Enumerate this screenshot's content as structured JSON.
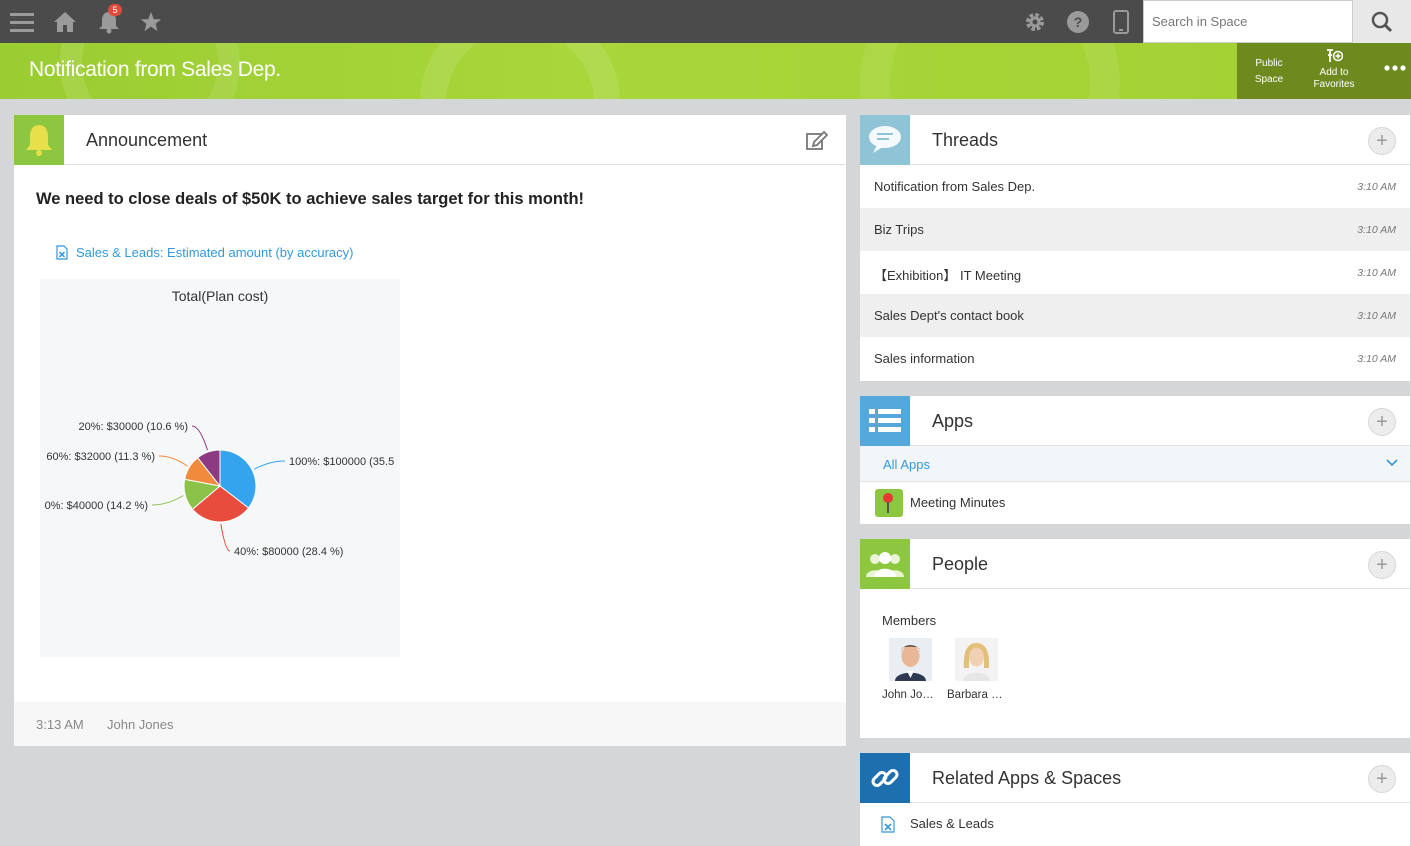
{
  "header": {
    "notification_count": "5",
    "search_placeholder": "Search in Space"
  },
  "space": {
    "title": "Notification from Sales Dep.",
    "public_label_1": "Public",
    "public_label_2": "Space",
    "favorites_label_1": "Add to",
    "favorites_label_2": "Favorites"
  },
  "announcement": {
    "title": "Announcement",
    "headline": "We need to close deals of $50K to achieve sales target for this month!",
    "link_text": "Sales & Leads: Estimated amount (by accuracy)",
    "footer_time": "3:13 AM",
    "footer_author": "John Jones"
  },
  "chart_data": {
    "type": "pie",
    "title": "Total(Plan cost)",
    "slices": [
      {
        "label": "100%: $100000 (35.5",
        "value": 100000,
        "percent": 35.5,
        "color": "#35a4ee"
      },
      {
        "label": "40%: $80000 (28.4 %)",
        "value": 80000,
        "percent": 28.4,
        "color": "#e74c3c"
      },
      {
        "label": "0%: $40000 (14.2 %)",
        "value": 40000,
        "percent": 14.2,
        "color": "#8bc34a"
      },
      {
        "label": "60%: $32000 (11.3 %)",
        "value": 32000,
        "percent": 11.3,
        "color": "#f08a3c"
      },
      {
        "label": "20%: $30000 (10.6 %)",
        "value": 30000,
        "percent": 10.6,
        "color": "#8e3a82"
      }
    ]
  },
  "threads": {
    "title": "Threads",
    "items": [
      {
        "name": "Notification from Sales Dep.",
        "time": "3:10 AM"
      },
      {
        "name": "Biz Trips",
        "time": "3:10 AM"
      },
      {
        "name": "【Exhibition】 IT Meeting",
        "time": "3:10 AM"
      },
      {
        "name": "Sales Dept's contact book",
        "time": "3:10 AM"
      },
      {
        "name": "Sales information",
        "time": "3:10 AM"
      }
    ]
  },
  "apps": {
    "title": "Apps",
    "filter": "All Apps",
    "items": [
      {
        "name": "Meeting Minutes"
      }
    ]
  },
  "people": {
    "title": "People",
    "members_label": "Members",
    "members": [
      {
        "name": "John Jo…"
      },
      {
        "name": "Barbara …"
      }
    ]
  },
  "related": {
    "title": "Related Apps & Spaces",
    "items": [
      {
        "name": "Sales & Leads"
      }
    ]
  }
}
